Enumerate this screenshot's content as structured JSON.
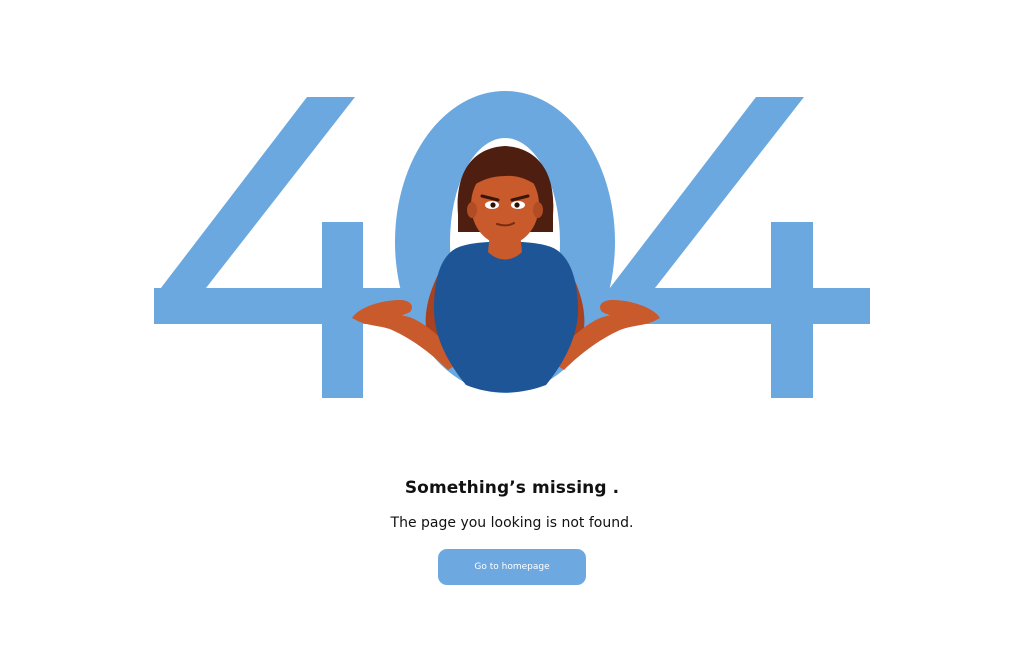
{
  "error": {
    "code_digits": [
      "4",
      "0",
      "4"
    ]
  },
  "message": {
    "heading": "Something’s missing .",
    "subtext": "The page you looking is not found."
  },
  "actions": {
    "home_button_label": "Go to homepage"
  },
  "colors": {
    "digits": "#6ba8e0",
    "shirt": "#1e5596",
    "skin": "#c85a2c",
    "hair": "#4e1f10",
    "button": "#6da8e0"
  }
}
